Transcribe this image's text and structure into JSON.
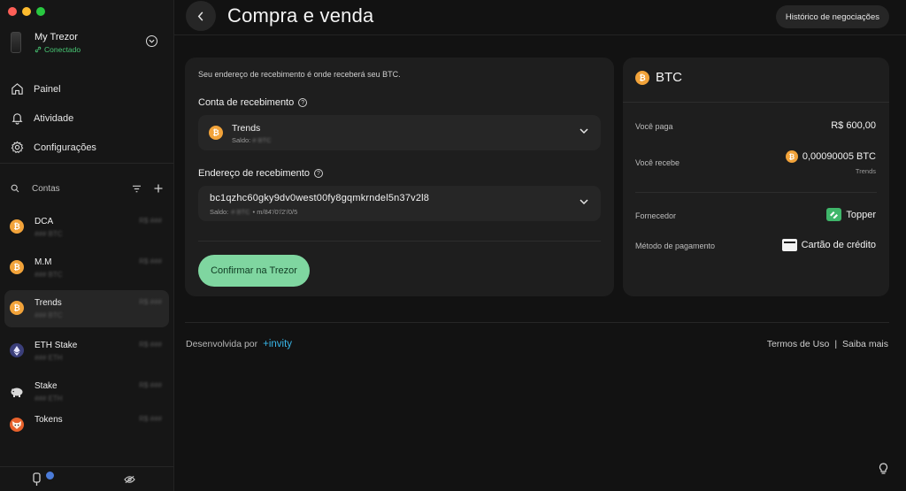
{
  "sidebar": {
    "device": {
      "name": "My Trezor",
      "status": "Conectado"
    },
    "nav": [
      {
        "label": "Painel",
        "icon": "home-icon"
      },
      {
        "label": "Atividade",
        "icon": "bell-icon"
      },
      {
        "label": "Configurações",
        "icon": "gear-icon"
      }
    ],
    "accounts_label": "Contas",
    "accounts": [
      {
        "name": "DCA",
        "balance": "### BTC",
        "fiat": "R$ ###",
        "icon": "bitcoin-icon"
      },
      {
        "name": "M.M",
        "balance": "### BTC",
        "fiat": "R$ ###",
        "icon": "bitcoin-icon"
      },
      {
        "name": "Trends",
        "balance": "### BTC",
        "fiat": "R$ ###",
        "icon": "bitcoin-icon"
      },
      {
        "name": "ETH Stake",
        "balance": "### ETH",
        "fiat": "R$ ###",
        "icon": "ethereum-icon"
      },
      {
        "name": "Stake",
        "balance": "### ETH",
        "fiat": "R$ ###",
        "icon": "piggy-bank-icon"
      },
      {
        "name": "Tokens",
        "balance": "",
        "fiat": "R$ ###",
        "icon": "fox-icon"
      }
    ]
  },
  "header": {
    "title": "Compra e venda",
    "history_button": "Histórico de negociações"
  },
  "form": {
    "intro": "Seu endereço de recebimento é onde receberá seu BTC.",
    "account_label": "Conta de recebimento",
    "account_name": "Trends",
    "account_balance_label": "Saldo:",
    "account_balance_value": "# BTC",
    "address_label": "Endereço de recebimento",
    "address": "bc1qzhc60gky9dv0west00fy8gqmkrndel5n37v2l8",
    "address_balance_label": "Saldo:",
    "address_balance_value": "# BTC",
    "address_path": "• m/84'/0'/2'/0/5",
    "confirm_button": "Confirmar na Trezor"
  },
  "summary": {
    "coin": "BTC",
    "you_pay_label": "Você paga",
    "you_pay_value": "R$ 600,00",
    "you_receive_label": "Você recebe",
    "you_receive_value": "0,00090005 BTC",
    "you_receive_account": "Trends",
    "provider_label": "Fornecedor",
    "provider_value": "Topper",
    "payment_method_label": "Método de pagamento",
    "payment_method_value": "Cartão de crédito"
  },
  "footer": {
    "powered_by": "Desenvolvida por",
    "brand": "+invity",
    "terms": "Termos de Uso",
    "separator": "|",
    "learn_more": "Saiba mais"
  },
  "colors": {
    "accent_green": "#7fd6a0",
    "bitcoin_orange": "#f2a33a",
    "status_green": "#48c774",
    "invity_blue": "#38b6e8"
  }
}
